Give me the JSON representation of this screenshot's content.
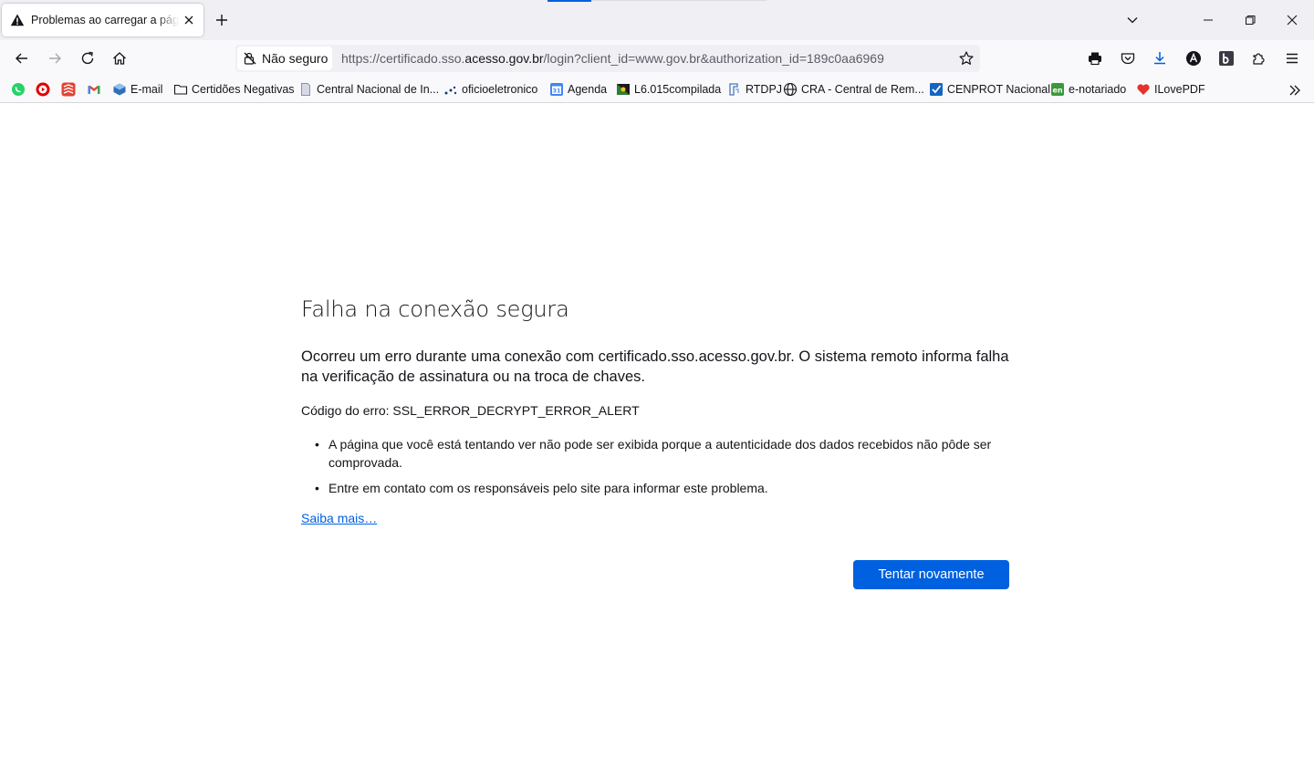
{
  "tab": {
    "title": "Problemas ao carregar a página",
    "warn_icon": "warning-icon",
    "close_icon": "close-icon"
  },
  "window_controls": [
    "tab-list-chevron-icon",
    "minimize-icon",
    "restore-icon",
    "close-icon"
  ],
  "nav": {
    "identity_label": "Não seguro",
    "url_prefix": "https://certificado.sso.",
    "url_host": "acesso.gov.br",
    "url_path": "/login?client_id=www.gov.br&authorization_id=189c0aa6969"
  },
  "toolbar_icons": [
    "print-icon",
    "pocket-icon",
    "downloads-icon",
    "extension-a-icon",
    "extension-b-icon",
    "extensions-puzzle-icon",
    "menu-icon"
  ],
  "bookmarks": [
    {
      "label": "",
      "icon": "whatsapp-icon"
    },
    {
      "label": "",
      "icon": "youtube-icon"
    },
    {
      "label": "",
      "icon": "todoist-icon"
    },
    {
      "label": "",
      "icon": "gmail-icon"
    },
    {
      "label": "E-mail",
      "icon": "mail-cube-icon"
    },
    {
      "label": "Certidões Negativas",
      "icon": "folder-icon"
    },
    {
      "label": "Central Nacional de In...",
      "icon": "page-icon"
    },
    {
      "label": "oficioeletronico",
      "icon": "dots-icon"
    },
    {
      "label": "Agenda",
      "icon": "calendar-icon"
    },
    {
      "label": "L6.015compilada",
      "icon": "flag-icon"
    },
    {
      "label": "RTDPJ",
      "icon": "rtdpj-icon"
    },
    {
      "label": "CRA - Central de Rem...",
      "icon": "globe-icon"
    },
    {
      "label": "CENPROT Nacional",
      "icon": "check-icon"
    },
    {
      "label": "e-notariado",
      "icon": "enotariado-icon"
    },
    {
      "label": "ILovePDF",
      "icon": "heart-icon"
    }
  ],
  "error": {
    "title": "Falha na conexão segura",
    "description": "Ocorreu um erro durante uma conexão com certificado.sso.acesso.gov.br. O sistema remoto informa falha na verificação de assinatura ou na troca de chaves.",
    "code": "Código do erro: SSL_ERROR_DECRYPT_ERROR_ALERT",
    "bullets": [
      "A página que você está tentando ver não pode ser exibida porque a autenticidade dos dados recebidos não pôde ser comprovada.",
      "Entre em contato com os responsáveis pelo site para informar este problema."
    ],
    "learn_more": "Saiba mais…",
    "retry_label": "Tentar novamente"
  },
  "colors": {
    "accent": "#0061e0",
    "tabstrip_bg": "#f0f0f4",
    "toolbar_bg": "#f9f9fb",
    "text": "#15141a"
  }
}
